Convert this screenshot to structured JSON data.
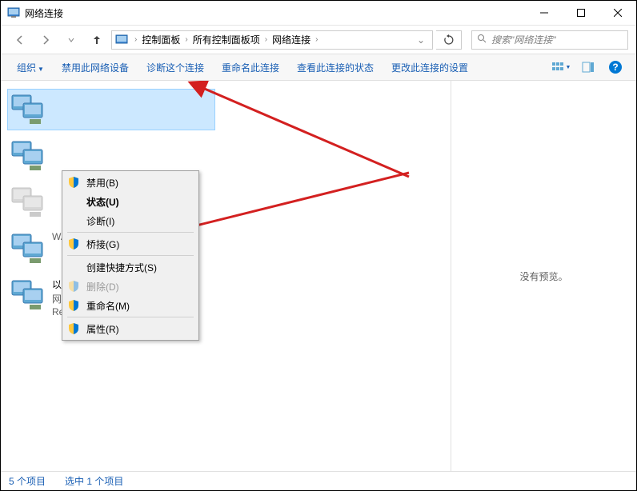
{
  "window": {
    "title": "网络连接"
  },
  "breadcrumb": {
    "items": [
      "控制面板",
      "所有控制面板项",
      "网络连接"
    ]
  },
  "search": {
    "placeholder": "搜索\"网络连接\""
  },
  "toolbar": {
    "organize": "组织",
    "disable": "禁用此网络设备",
    "diagnose": "诊断这个连接",
    "rename": "重命名此连接",
    "status": "查看此连接的状态",
    "settings": "更改此连接的设置"
  },
  "connections": [
    {
      "name": "",
      "status": "",
      "device": ""
    },
    {
      "name": "",
      "status": "",
      "device": ""
    },
    {
      "name": "",
      "status": "",
      "device": ""
    },
    {
      "name": "",
      "status": "",
      "device": "WAN Miniport (PPTP)"
    },
    {
      "name": "以太网",
      "status": "网络 4",
      "device": "Realtek PCIe GBE Family Contr..."
    }
  ],
  "contextMenu": {
    "disable": "禁用(B)",
    "status": "状态(U)",
    "diagnose": "诊断(I)",
    "bridge": "桥接(G)",
    "shortcut": "创建快捷方式(S)",
    "delete": "删除(D)",
    "rename": "重命名(M)",
    "properties": "属性(R)"
  },
  "preview": {
    "noPreview": "没有预览。"
  },
  "statusbar": {
    "count": "5 个项目",
    "selected": "选中 1 个项目"
  }
}
